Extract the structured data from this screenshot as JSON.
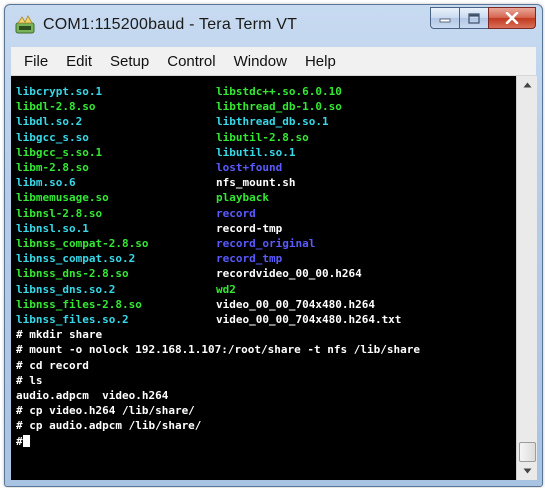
{
  "window": {
    "title": "COM1:115200baud - Tera Term VT",
    "icon": "tera-term-icon",
    "buttons": [
      "minimize-icon",
      "maximize-icon",
      "close-icon"
    ]
  },
  "menu": [
    "File",
    "Edit",
    "Setup",
    "Control",
    "Window",
    "Help"
  ],
  "colors": {
    "terminal_bg": "#000000",
    "green": "#33e833",
    "cyan": "#37d8e8",
    "blue": "#5a5aff",
    "white": "#ffffff"
  },
  "terminal": {
    "listing": [
      {
        "left": "libcrypt.so.1",
        "left_color": "#37d8e8",
        "right": "libstdc++.so.6.0.10",
        "right_color": "#33e833"
      },
      {
        "left": "libdl-2.8.so",
        "left_color": "#33e833",
        "right": "libthread_db-1.0.so",
        "right_color": "#33e833"
      },
      {
        "left": "libdl.so.2",
        "left_color": "#37d8e8",
        "right": "libthread_db.so.1",
        "right_color": "#37d8e8"
      },
      {
        "left": "libgcc_s.so",
        "left_color": "#37d8e8",
        "right": "libutil-2.8.so",
        "right_color": "#33e833"
      },
      {
        "left": "libgcc_s.so.1",
        "left_color": "#33e833",
        "right": "libutil.so.1",
        "right_color": "#37d8e8"
      },
      {
        "left": "libm-2.8.so",
        "left_color": "#33e833",
        "right": "lost+found",
        "right_color": "#5a5aff"
      },
      {
        "left": "libm.so.6",
        "left_color": "#37d8e8",
        "right": "nfs_mount.sh",
        "right_color": "#ffffff"
      },
      {
        "left": "libmemusage.so",
        "left_color": "#33e833",
        "right": "playback",
        "right_color": "#33e833"
      },
      {
        "left": "libnsl-2.8.so",
        "left_color": "#33e833",
        "right": "record",
        "right_color": "#5a5aff"
      },
      {
        "left": "libnsl.so.1",
        "left_color": "#37d8e8",
        "right": "record-tmp",
        "right_color": "#ffffff"
      },
      {
        "left": "libnss_compat-2.8.so",
        "left_color": "#33e833",
        "right": "record_original",
        "right_color": "#5a5aff"
      },
      {
        "left": "libnss_compat.so.2",
        "left_color": "#37d8e8",
        "right": "record_tmp",
        "right_color": "#5a5aff"
      },
      {
        "left": "libnss_dns-2.8.so",
        "left_color": "#33e833",
        "right": "recordvideo_00_00.h264",
        "right_color": "#ffffff"
      },
      {
        "left": "libnss_dns.so.2",
        "left_color": "#37d8e8",
        "right": "wd2",
        "right_color": "#33e833"
      },
      {
        "left": "libnss_files-2.8.so",
        "left_color": "#33e833",
        "right": "video_00_00_704x480.h264",
        "right_color": "#ffffff"
      },
      {
        "left": "libnss_files.so.2",
        "left_color": "#37d8e8",
        "right": "video_00_00_704x480.h264.txt",
        "right_color": "#ffffff"
      }
    ],
    "commands": [
      "# mkdir share",
      "# mount -o nolock 192.168.1.107:/root/share -t nfs /lib/share",
      "# cd record",
      "# ls",
      "audio.adpcm  video.h264",
      "# cp video.h264 /lib/share/",
      "# cp audio.adpcm /lib/share/",
      "#"
    ]
  },
  "scrollbar": {
    "up": "scroll-up-arrow-icon",
    "down": "scroll-down-arrow-icon"
  }
}
